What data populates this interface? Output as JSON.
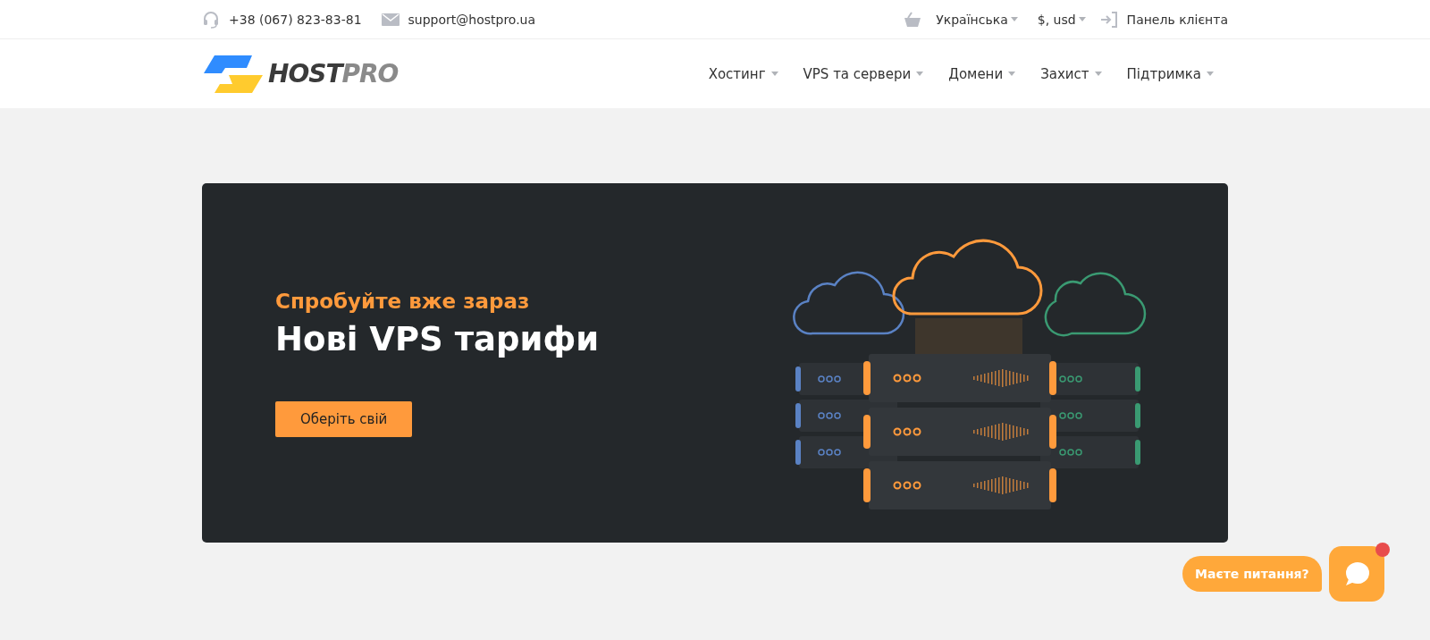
{
  "top_bar": {
    "phone": "+38 (067) 823-83-81",
    "email": "support@hostpro.ua",
    "language": "Українська",
    "currency": "$, usd",
    "client_panel": "Панель клієнта"
  },
  "header": {
    "logo_primary": "HOST",
    "logo_secondary": "PRO",
    "nav": [
      {
        "label": "Хостинг"
      },
      {
        "label": "VPS та сервери"
      },
      {
        "label": "Домени"
      },
      {
        "label": "Захист"
      },
      {
        "label": "Підтримка"
      }
    ]
  },
  "banner": {
    "subtitle": "Спробуйте вже зараз",
    "title": "Нові VPS тарифи",
    "button": "Оберіть свій"
  },
  "chat": {
    "prompt": "Маєте питання?"
  }
}
